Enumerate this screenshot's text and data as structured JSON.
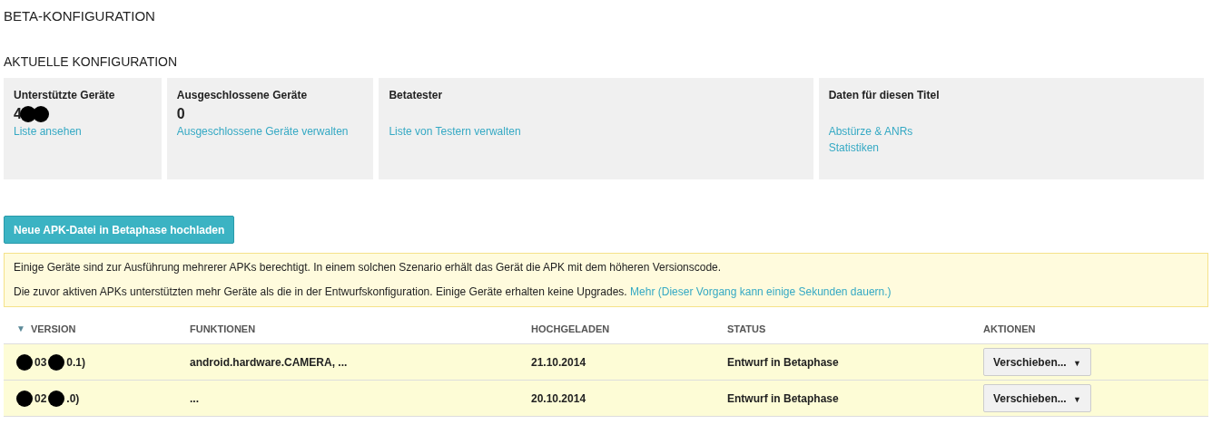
{
  "page_title": "BETA-KONFIGURATION",
  "section_title": "AKTUELLE KONFIGURATION",
  "cards": [
    {
      "title": "Unterstützte Geräte",
      "value": "4",
      "redacted": true,
      "links": [
        "Liste ansehen"
      ]
    },
    {
      "title": "Ausgeschlossene Geräte",
      "value": "0",
      "redacted": false,
      "links": [
        "Ausgeschlossene Geräte verwalten"
      ]
    },
    {
      "title": "Betatester",
      "links": [
        "Liste von Testern verwalten"
      ]
    },
    {
      "title": "Daten für diesen Titel",
      "links": [
        "Abstürze & ANRs",
        "Statistiken"
      ]
    }
  ],
  "upload_button": "Neue APK-Datei in Betaphase hochladen",
  "notice": {
    "lines": [
      "Einige Geräte sind zur Ausführung mehrerer APKs berechtigt. In einem solchen Szenario erhält das Gerät die APK mit dem höheren Versionscode.",
      "Die zuvor aktiven APKs unterstützten mehr Geräte als die in der Entwurfskonfiguration. Einige Geräte erhalten keine Upgrades."
    ],
    "link": "Mehr (Dieser Vorgang kann einige Sekunden dauern.)"
  },
  "table": {
    "sort_indicator": "▼",
    "columns": [
      "VERSION",
      "FUNKTIONEN",
      "HOCHGELADEN",
      "STATUS",
      "AKTIONEN"
    ],
    "rows": [
      {
        "version_parts": [
          "03",
          "0.1)"
        ],
        "redacted": true,
        "features": "android.hardware.CAMERA, ...",
        "uploaded": "21.10.2014",
        "status": "Entwurf in Betaphase",
        "action": "Verschieben...",
        "action_caret": "▼"
      },
      {
        "version_parts": [
          "02",
          ".0)"
        ],
        "redacted": true,
        "features": "...",
        "uploaded": "20.10.2014",
        "status": "Entwurf in Betaphase",
        "action": "Verschieben...",
        "action_caret": "▼"
      }
    ]
  }
}
